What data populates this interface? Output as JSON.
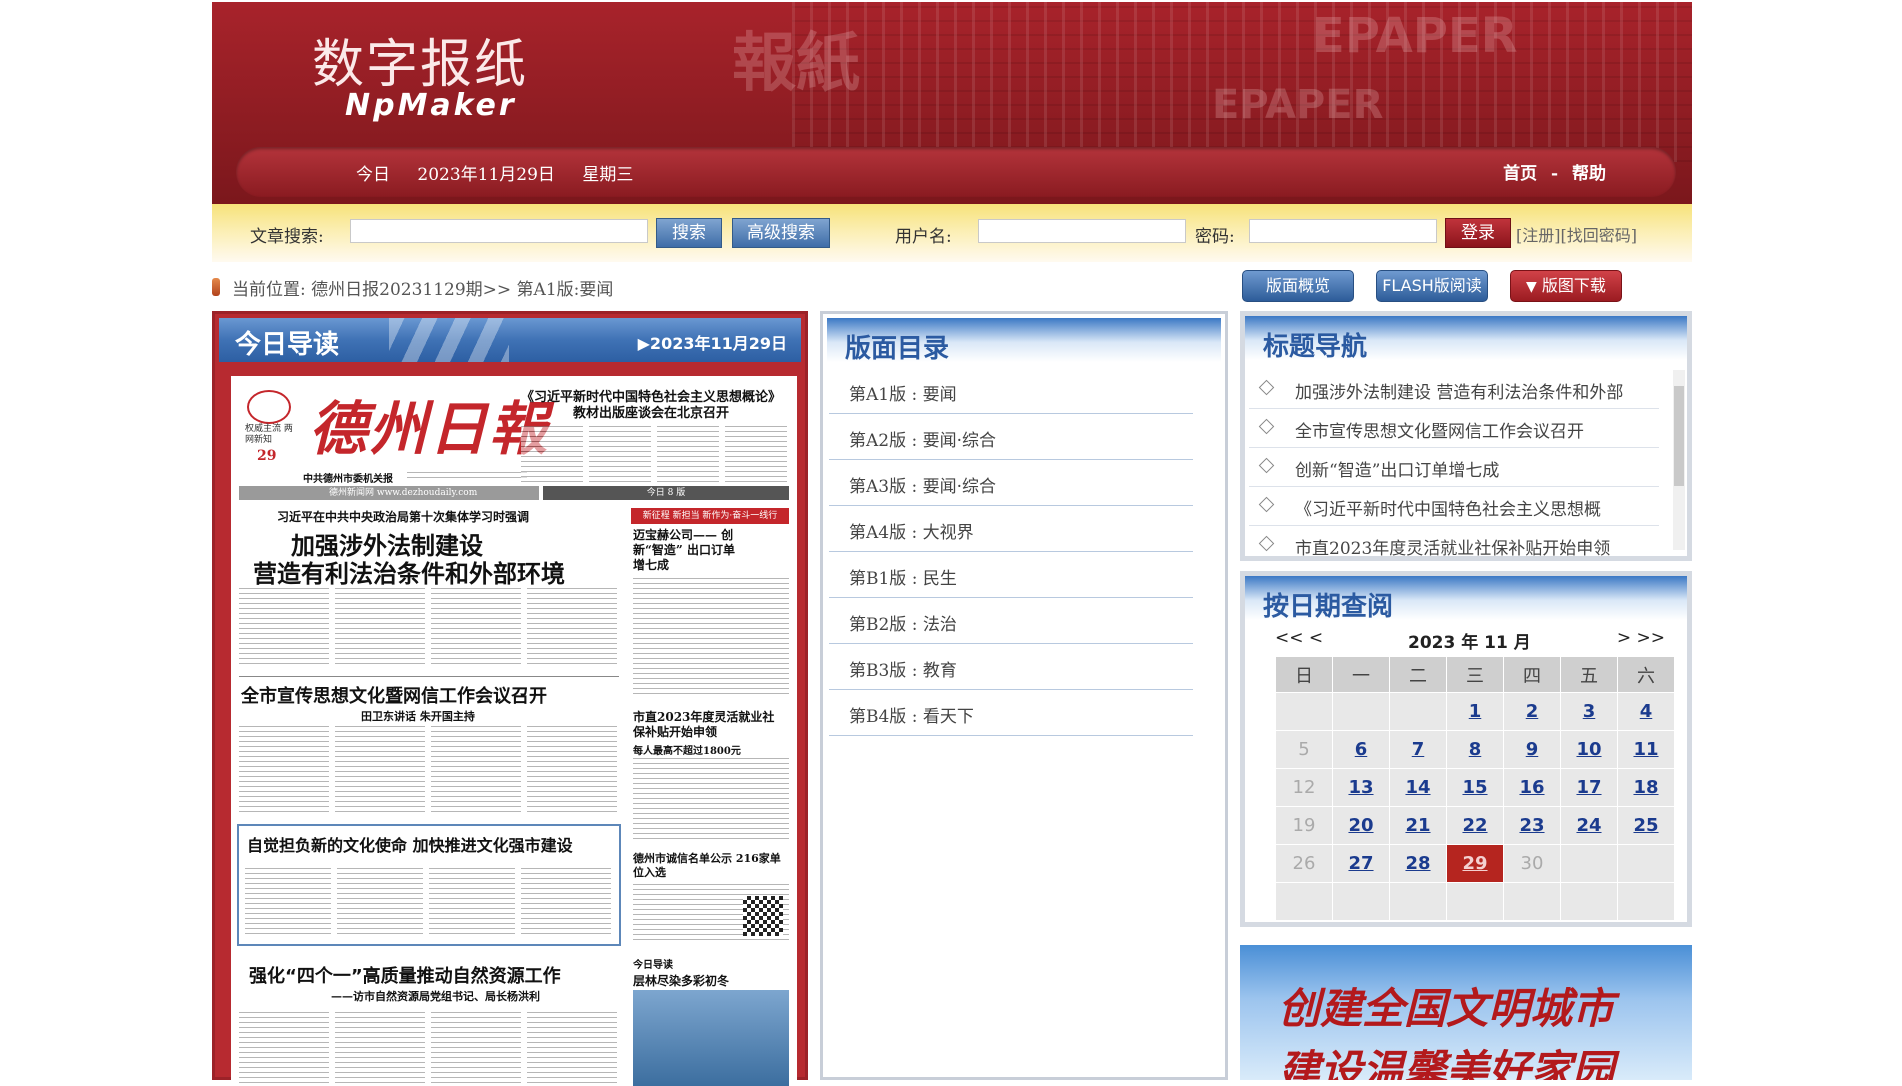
{
  "header": {
    "logo_cn": "数字报纸",
    "logo_en": "NpMaker",
    "today_label": "今日",
    "date": "2023年11月29日",
    "weekday": "星期三",
    "nav_home": "首页",
    "nav_sep": "-",
    "nav_help": "帮助"
  },
  "search": {
    "label": "文章搜索:",
    "search_button": "搜索",
    "advanced_button": "高级搜索",
    "username_label": "用户名:",
    "password_label": "密码:",
    "login_button": "登录",
    "register_link": "[注册]",
    "recover_link": "[找回密码]"
  },
  "location": {
    "text": "当前位置: 德州日报20231129期>> 第A1版:要闻"
  },
  "actions": {
    "overview": "版面概览",
    "flash": "FLASH版阅读",
    "download": "版图下载"
  },
  "today_guide": {
    "title": "今日导读",
    "date": "▶2023年11月29日"
  },
  "newspaper": {
    "masthead": "德州日報",
    "badge": "权威主流 两网新知",
    "issue_day": "29",
    "org": "中共德州市委机关报",
    "site": "德州新闻网 www.dezhoudaily.com",
    "pages": "今日 8 版",
    "side_headline": "《习近平新时代中国特色社会主义思想概论》教材出版座谈会在北京召开",
    "kicker": "习近平在中共中央政治局第十次集体学习时强调",
    "headline_1": "加强涉外法制建设",
    "headline_2": "营造有利法治条件和外部环境",
    "headline_3": "全市宣传思想文化暨网信工作会议召开",
    "sub_3": "田卫东讲话 朱开国主持",
    "headline_4": "自觉担负新的文化使命 加快推进文化强市建设",
    "headline_5": "强化“四个一”高质量推动自然资源工作",
    "sub_5": "——访市自然资源局党组书记、局长杨洪利",
    "right_tag": "新征程 新担当 新作为·奋斗一线行",
    "right_head": "迈宝赫公司—— 创新“智造” 出口订单增七成",
    "right_head2": "市直2023年度灵活就业社保补贴开始申领",
    "right_sub2": "每人最高不超过1800元",
    "right_head3": "德州市诚信名单公示 216家单位入选",
    "right_head4": "今日导读",
    "right_head5": "层林尽染多彩初冬"
  },
  "editions": {
    "title": "版面目录",
    "items": [
      {
        "label": "第A1版 : 要闻"
      },
      {
        "label": "第A2版 : 要闻·综合"
      },
      {
        "label": "第A3版 : 要闻·综合"
      },
      {
        "label": "第A4版 : 大视界"
      },
      {
        "label": "第B1版 : 民生"
      },
      {
        "label": "第B2版 : 法治"
      },
      {
        "label": "第B3版 : 教育"
      },
      {
        "label": "第B4版 : 看天下"
      }
    ]
  },
  "title_nav": {
    "title": "标题导航",
    "items": [
      {
        "label": "加强涉外法制建设 营造有利法治条件和外部"
      },
      {
        "label": "全市宣传思想文化暨网信工作会议召开"
      },
      {
        "label": "创新“智造”出口订单增七成"
      },
      {
        "label": "《习近平新时代中国特色社会主义思想概"
      },
      {
        "label": "市直2023年度灵活就业社保补贴开始申领"
      }
    ]
  },
  "calendar": {
    "title": "按日期查阅",
    "prev": "<< <",
    "month": "2023 年 11 月",
    "next": "> >>",
    "weekdays": [
      "日",
      "一",
      "二",
      "三",
      "四",
      "五",
      "六"
    ],
    "weeks": [
      [
        "",
        "",
        "",
        "1",
        "2",
        "3",
        "4"
      ],
      [
        "5",
        "6",
        "7",
        "8",
        "9",
        "10",
        "11"
      ],
      [
        "12",
        "13",
        "14",
        "15",
        "16",
        "17",
        "18"
      ],
      [
        "19",
        "20",
        "21",
        "22",
        "23",
        "24",
        "25"
      ],
      [
        "26",
        "27",
        "28",
        "29",
        "30",
        "",
        ""
      ],
      [
        "",
        "",
        "",
        "",
        "",
        "",
        ""
      ]
    ],
    "linked_days": [
      "1",
      "2",
      "3",
      "4",
      "6",
      "7",
      "8",
      "9",
      "10",
      "11",
      "13",
      "14",
      "15",
      "16",
      "17",
      "18",
      "20",
      "21",
      "22",
      "23",
      "24",
      "25",
      "27",
      "28",
      "29"
    ],
    "today": "29"
  },
  "banner": {
    "line1": "创建全国文明城市",
    "line2": "建设温馨美好家园"
  },
  "colors": {
    "brand_red": "#8d1c22",
    "accent_blue": "#2b5aa1",
    "today_cell": "#b5251f"
  }
}
